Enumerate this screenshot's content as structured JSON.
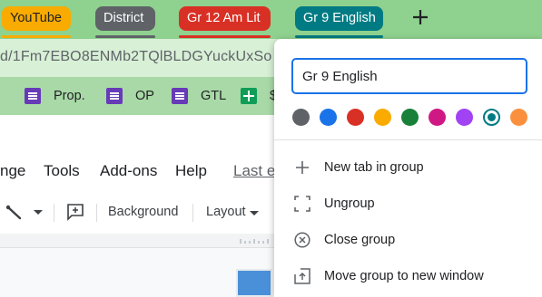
{
  "tab_groups": [
    {
      "label": "YouTube",
      "color": "#f9ab00"
    },
    {
      "label": "District",
      "color": "#5f6368"
    },
    {
      "label": "Gr 12 Am Lit",
      "color": "#d93025"
    },
    {
      "label": "Gr 9 English",
      "color": "#007b83"
    }
  ],
  "new_tab_icon": "plus-icon",
  "address_bar": {
    "url_fragment": "d/1Fm7EBO8ENMb2TQlBLDGYuckUxSo"
  },
  "bookmarks": [
    {
      "label": "Prop.",
      "icon": "forms-icon"
    },
    {
      "label": "OP",
      "icon": "forms-icon"
    },
    {
      "label": "GTL",
      "icon": "forms-icon"
    },
    {
      "label": "$",
      "icon": "sheets-icon"
    }
  ],
  "docs_menu": {
    "items": [
      "nge",
      "Tools",
      "Add-ons",
      "Help"
    ],
    "last_edit": "Last e"
  },
  "docs_toolbar": {
    "background_label": "Background",
    "layout_label": "Layout"
  },
  "group_menu": {
    "name_value": "Gr 9 English",
    "colors": [
      "#5f6368",
      "#1a73e8",
      "#d93025",
      "#f9ab00",
      "#188038",
      "#d01884",
      "#a142f4",
      "#007b83",
      "#fa903e"
    ],
    "selected_color": "#007b83",
    "options": [
      {
        "label": "New tab in group",
        "icon": "plus-icon"
      },
      {
        "label": "Ungroup",
        "icon": "ungroup-icon"
      },
      {
        "label": "Close group",
        "icon": "close-circle-icon"
      },
      {
        "label": "Move group to new window",
        "icon": "open-in-new-window-icon"
      }
    ]
  }
}
